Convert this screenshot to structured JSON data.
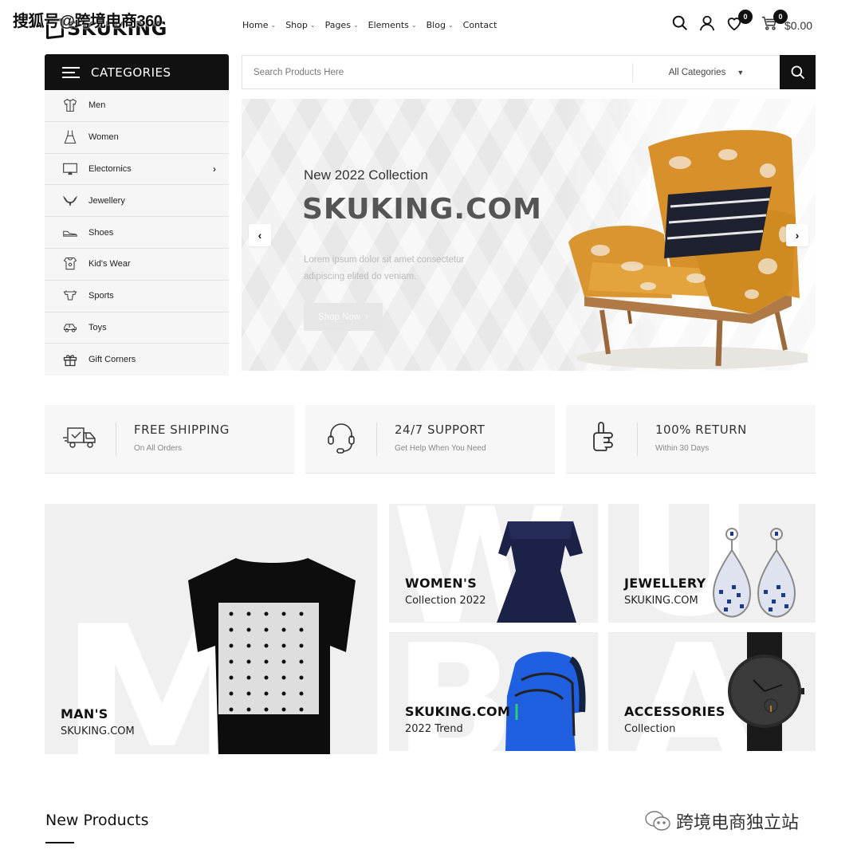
{
  "overlay": {
    "top_watermark": "搜狐号@跨境电商360",
    "bottom_watermark": "跨境电商独立站"
  },
  "header": {
    "logo_text": "SKUKING",
    "nav": [
      {
        "label": "Home",
        "has_dropdown": true
      },
      {
        "label": "Shop",
        "has_dropdown": true
      },
      {
        "label": "Pages",
        "has_dropdown": true
      },
      {
        "label": "Elements",
        "has_dropdown": true
      },
      {
        "label": "Blog",
        "has_dropdown": true
      },
      {
        "label": "Contact",
        "has_dropdown": false
      }
    ],
    "wishlist_count": "0",
    "cart_count": "0",
    "cart_total": "$0.00",
    "icons": [
      "search-icon",
      "user-icon",
      "heart-icon",
      "cart-icon"
    ]
  },
  "categories": {
    "title": "CATEGORIES",
    "items": [
      {
        "label": "Men",
        "icon": "shirt-icon",
        "has_submenu": false
      },
      {
        "label": "Women",
        "icon": "dress-icon",
        "has_submenu": false
      },
      {
        "label": "Electornics",
        "icon": "monitor-icon",
        "has_submenu": true
      },
      {
        "label": "Jewellery",
        "icon": "necklace-icon",
        "has_submenu": false
      },
      {
        "label": "Shoes",
        "icon": "shoe-icon",
        "has_submenu": false
      },
      {
        "label": "Kid's Wear",
        "icon": "baby-clothes-icon",
        "has_submenu": false
      },
      {
        "label": "Sports",
        "icon": "jersey-icon",
        "has_submenu": false
      },
      {
        "label": "Toys",
        "icon": "toy-car-icon",
        "has_submenu": false
      },
      {
        "label": "Gift Corners",
        "icon": "gift-icon",
        "has_submenu": false
      }
    ]
  },
  "search": {
    "placeholder": "Search Products Here",
    "value": "",
    "category_selected": "All Categories"
  },
  "hero": {
    "subtitle": "New 2022 Collection",
    "title": "SKUKING.COM",
    "description": "Lorem ipsum dolor sit amet consectetur adipiscing elited do veniam.",
    "button_label": "Shop Now",
    "prev_label": "‹",
    "next_label": "›"
  },
  "features": [
    {
      "title": "FREE SHIPPING",
      "subtitle": "On All Orders",
      "icon": "truck-icon"
    },
    {
      "title": "24/7 SUPPORT",
      "subtitle": "Get Help When You Need",
      "icon": "headset-icon"
    },
    {
      "title": "100% RETURN",
      "subtitle": "Within 30 Days",
      "icon": "thumbs-up-icon"
    }
  ],
  "banners": {
    "men": {
      "title": "MAN'S",
      "subtitle": "SKUKING.COM",
      "letter": "M"
    },
    "women": {
      "title": "WOMEN'S",
      "subtitle": "Collection 2022",
      "letter": "W"
    },
    "jewellery": {
      "title": "JEWELLERY",
      "subtitle": "SKUKING.COM",
      "letter": "U"
    },
    "bag": {
      "title": "SKUKING.COM",
      "subtitle": "2022 Trend",
      "letter": "B"
    },
    "accessories": {
      "title": "ACCESSORIES",
      "subtitle": "Collection",
      "letter": "A"
    }
  },
  "new_products": {
    "title": "New Products"
  }
}
